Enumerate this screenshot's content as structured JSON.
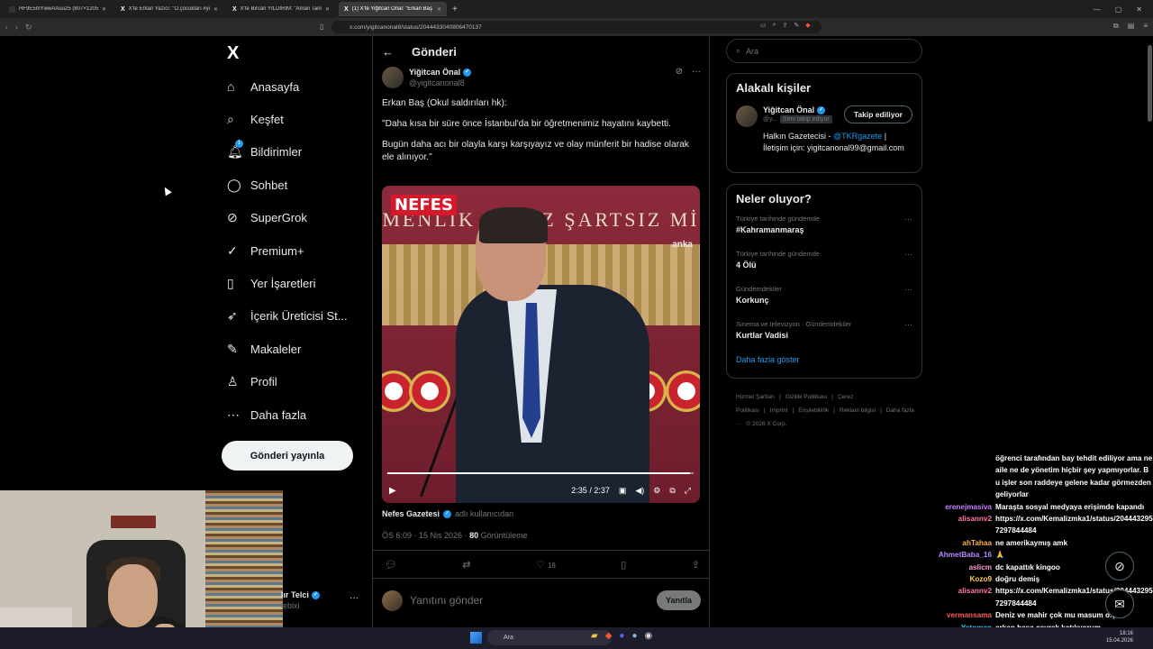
{
  "browser": {
    "tabs": [
      {
        "title": "HF9E5mYwwAAuu25 (807×1205)",
        "active": false,
        "x_favicon": false
      },
      {
        "title": "X'te Erkan Yazıcı: \"O.çocukları #yusuf",
        "active": false,
        "x_favicon": true
      },
      {
        "title": "X'te Bircan YILDIRIM: \"Aman Tanrım",
        "active": false,
        "x_favicon": true
      },
      {
        "title": "(1) X'te Yiğitcan Önal: \"Erkan Baş",
        "active": true,
        "x_favicon": true
      }
    ],
    "url": "x.com/yigitcanonal8/status/2044433040806470137"
  },
  "x_logo": "X",
  "nav": {
    "items": [
      {
        "label": "Anasayfa",
        "icon": "home-icon",
        "glyph": "⌂"
      },
      {
        "label": "Keşfet",
        "icon": "search-icon",
        "glyph": "⌕"
      },
      {
        "label": "Bildirimler",
        "icon": "bell-icon",
        "glyph": "🔔︎",
        "badge": "1"
      },
      {
        "label": "Sohbet",
        "icon": "chat-icon",
        "glyph": "◯"
      },
      {
        "label": "SuperGrok",
        "icon": "grok-icon",
        "glyph": "⊘"
      },
      {
        "label": "Premium+",
        "icon": "premium-icon",
        "glyph": "✓"
      },
      {
        "label": "Yer İşaretleri",
        "icon": "bookmark-icon",
        "glyph": "▯"
      },
      {
        "label": "İçerik Üreticisi St...",
        "icon": "rocket-icon",
        "glyph": "➶"
      },
      {
        "label": "Makaleler",
        "icon": "article-icon",
        "glyph": "✎"
      },
      {
        "label": "Profil",
        "icon": "profile-icon",
        "glyph": "♙"
      },
      {
        "label": "Daha fazla",
        "icon": "more-circle-icon",
        "glyph": "⋯"
      }
    ],
    "post_button": "Gönderi yayınla",
    "account_name": "lır Telci",
    "account_handle": "lebixi"
  },
  "post": {
    "header_title": "Gönderi",
    "author_name": "Yiğitcan Önal",
    "author_handle": "@yigitcanonal8",
    "paragraphs": [
      "Erkan Baş (Okul saldırıları hk):",
      "\"Daha kısa bir süre önce İstanbul'da bir öğretmenimiz hayatını kaybetti.",
      "Bugün daha acı bir olayla karşı karşıyayız ve olay münferit bir hadise olarak ele alınıyor.\""
    ],
    "video": {
      "channel_logo": "NEFES",
      "banner_text": "MENLİK KAYIZ ŞARTSIZ Mİ",
      "agency": "anka",
      "time": "2:35 / 2:37",
      "progress": 0.987
    },
    "source_name": "Nefes Gazetesi",
    "source_suffix": "adlı kullanıcıdan",
    "timestamp": "ÖS 6:09 · 15 Nis 2026 ·",
    "views_count": "80",
    "views_label": "Görüntüleme",
    "likes": "18",
    "reply_placeholder": "Yanıtını gönder",
    "reply_button": "Yanıtla"
  },
  "sidebar": {
    "search_placeholder": "Ara",
    "related_title": "Alakalı kişiler",
    "related_person": {
      "name": "Yiğitcan Önal",
      "handle": "@y...",
      "follows_you": "Seni takip ediyor",
      "follow_button": "Takip ediliyor",
      "bio_prefix": "Halkın Gazetecisi - ",
      "bio_link": "@TKRgazete",
      "bio_suffix": " | İletişim için: yigitcanonal99@gmail.com"
    },
    "trends_title": "Neler oluyor?",
    "trends": [
      {
        "context": "Türkiye tarihinde gündemde",
        "name": "#Kahramanmaraş"
      },
      {
        "context": "Türkiye tarihinde gündemde",
        "name": "4 Ölü"
      },
      {
        "context": "Gündemdekiler",
        "name": "Korkunç"
      },
      {
        "context": "Sinema ve televizyon · Gündemdekiler",
        "name": "Kurtlar Vadisi"
      }
    ],
    "show_more": "Daha fazla göster",
    "footer_links": [
      "Hizmet Şartları",
      "|",
      "Gizlilik Politikası",
      "|",
      "Çerez Politikası",
      "|",
      "Imprint",
      "|",
      "Erişilebilirlik",
      "|",
      "Reklam bilgisi",
      "|",
      "Daha fazla ···",
      "© 2026 X Corp."
    ]
  },
  "chat": {
    "messages": [
      {
        "user": "",
        "color": "#ffffff",
        "text": "öğrenci tarafından bay tehdit ediliyor ama ne aile ne de yönetim hiçbir şey yapmıyorlar. Bu işler son raddeye gelene kadar görmezden geliyorlar"
      },
      {
        "user": "erenejmasiva",
        "color": "#c77dff",
        "text": "Maraşta sosyal medyaya erişimde kapandı"
      },
      {
        "user": "alisannv2",
        "color": "#ff7aa2",
        "text": "https://x.com/Kemalizmka1/status/2044432957297844484"
      },
      {
        "user": "ahTahaa",
        "color": "#ffb347",
        "text": "ne amerikaymış amk"
      },
      {
        "user": "AhmetBaba_16",
        "color": "#b38cff",
        "text": "🙏"
      },
      {
        "user": "aslicm",
        "color": "#ff9ad5",
        "text": "dc kapattık kingoo"
      },
      {
        "user": "Kozo9",
        "color": "#ffd23f",
        "text": "doğru demiş"
      },
      {
        "user": "alisannv2",
        "color": "#ff7aa2",
        "text": "https://x.com/Kemalizmka1/status/2044432957297844484"
      },
      {
        "user": "vermansama",
        "color": "#ff5a5a",
        "text": "Deniz ve mahir çok mu masum o.ç"
      },
      {
        "user": "Yetomen",
        "color": "#40c4ff",
        "text": "erkan başa çeyrek katılıyorum"
      }
    ]
  },
  "taskbar": {
    "search": "Ara",
    "time": "18:16",
    "date": "15.04.2026"
  }
}
